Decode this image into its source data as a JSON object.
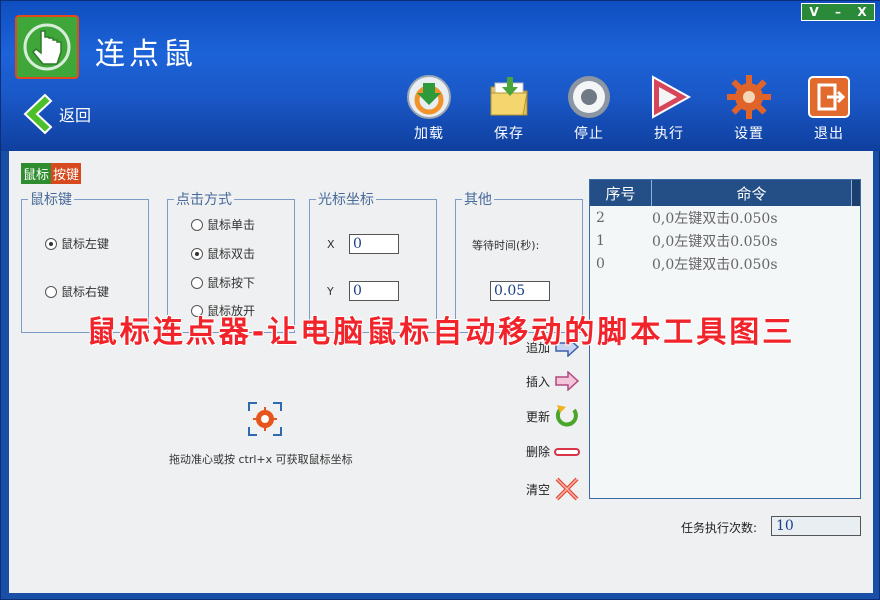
{
  "window": {
    "controls": [
      "V",
      "–",
      "X"
    ]
  },
  "header": {
    "title": "连点鼠",
    "back_label": "返回"
  },
  "toolbar": [
    {
      "id": "load",
      "label": "加载",
      "icon": "load-icon"
    },
    {
      "id": "save",
      "label": "保存",
      "icon": "save-folder-icon"
    },
    {
      "id": "stop",
      "label": "停止",
      "icon": "stop-icon"
    },
    {
      "id": "run",
      "label": "执行",
      "icon": "play-icon"
    },
    {
      "id": "settings",
      "label": "设置",
      "icon": "gear-icon"
    },
    {
      "id": "exit",
      "label": "退出",
      "icon": "exit-icon"
    }
  ],
  "mode_tag": {
    "part1": "鼠标",
    "part2": "按键"
  },
  "mouse_key": {
    "legend": "鼠标键",
    "options": [
      "鼠标左键",
      "鼠标右键"
    ],
    "selected": "鼠标左键"
  },
  "click_mode": {
    "legend": "点击方式",
    "options": [
      "鼠标单击",
      "鼠标双击",
      "鼠标按下",
      "鼠标放开"
    ],
    "selected": "鼠标双击"
  },
  "cursor_coord": {
    "legend": "光标坐标",
    "x_label": "X",
    "x_value": "0",
    "y_label": "Y",
    "y_value": "0"
  },
  "other": {
    "legend": "其他",
    "wait_label": "等待时间(秒):",
    "wait_value": "0.05"
  },
  "crosshair_hint": "拖动准心或按 ctrl+x 可获取鼠标坐标",
  "overlay_caption": "鼠标连点器-让电脑鼠标自动移动的脚本工具图三",
  "command_buttons": [
    {
      "label": "追加",
      "icon": "append-arrow-icon"
    },
    {
      "label": "插入",
      "icon": "insert-arrow-icon"
    },
    {
      "label": "更新",
      "icon": "refresh-icon"
    },
    {
      "label": "删除",
      "icon": "delete-bar-icon"
    },
    {
      "label": "清空",
      "icon": "clear-x-icon"
    }
  ],
  "command_list": {
    "columns": [
      "序号",
      "命令"
    ],
    "rows": [
      {
        "seq": "2",
        "cmd": "0,0左键双击0.050s"
      },
      {
        "seq": "1",
        "cmd": "0,0左键双击0.050s"
      },
      {
        "seq": "0",
        "cmd": "0,0左键双击0.050s"
      }
    ]
  },
  "task_count": {
    "label": "任务执行次数:",
    "value": "10"
  },
  "colors": {
    "header_blue": "#1c63d8",
    "overlay_red": "#f0242a",
    "list_header": "#234f86",
    "tag_green": "#2f8d2f",
    "tag_red": "#d64a1e"
  }
}
